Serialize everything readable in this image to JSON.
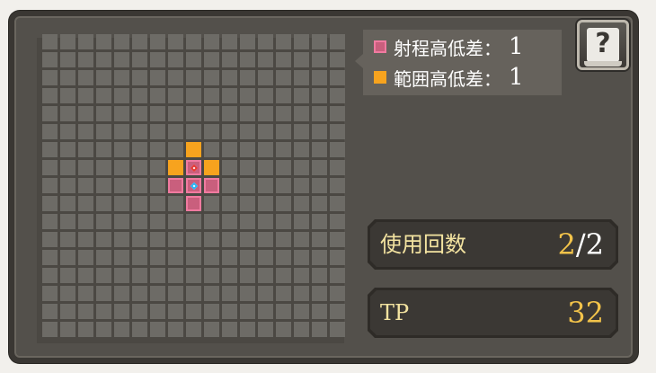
{
  "legend": {
    "range_height": {
      "label": "射程高低差：",
      "value": "1"
    },
    "area_height": {
      "label": "範囲高低差：",
      "value": "1"
    }
  },
  "help": {
    "label": "?"
  },
  "stats": {
    "uses": {
      "label": "使用回数",
      "current": "2",
      "separator": "/",
      "max": "2"
    },
    "tp": {
      "label": "TP",
      "value": "32"
    }
  },
  "grid": {
    "columns": 17,
    "rows": 17,
    "center": [
      8,
      8
    ],
    "range_cells": [
      [
        8,
        6
      ],
      [
        7,
        7
      ],
      [
        9,
        7
      ]
    ],
    "reach_cells": [
      [
        7,
        8
      ],
      [
        9,
        8
      ],
      [
        8,
        9
      ]
    ],
    "colors": {
      "empty": "#6d6b66",
      "range": "#f7a31e",
      "reach": "#c95f7d",
      "reach_border": "#f07aa0"
    }
  }
}
